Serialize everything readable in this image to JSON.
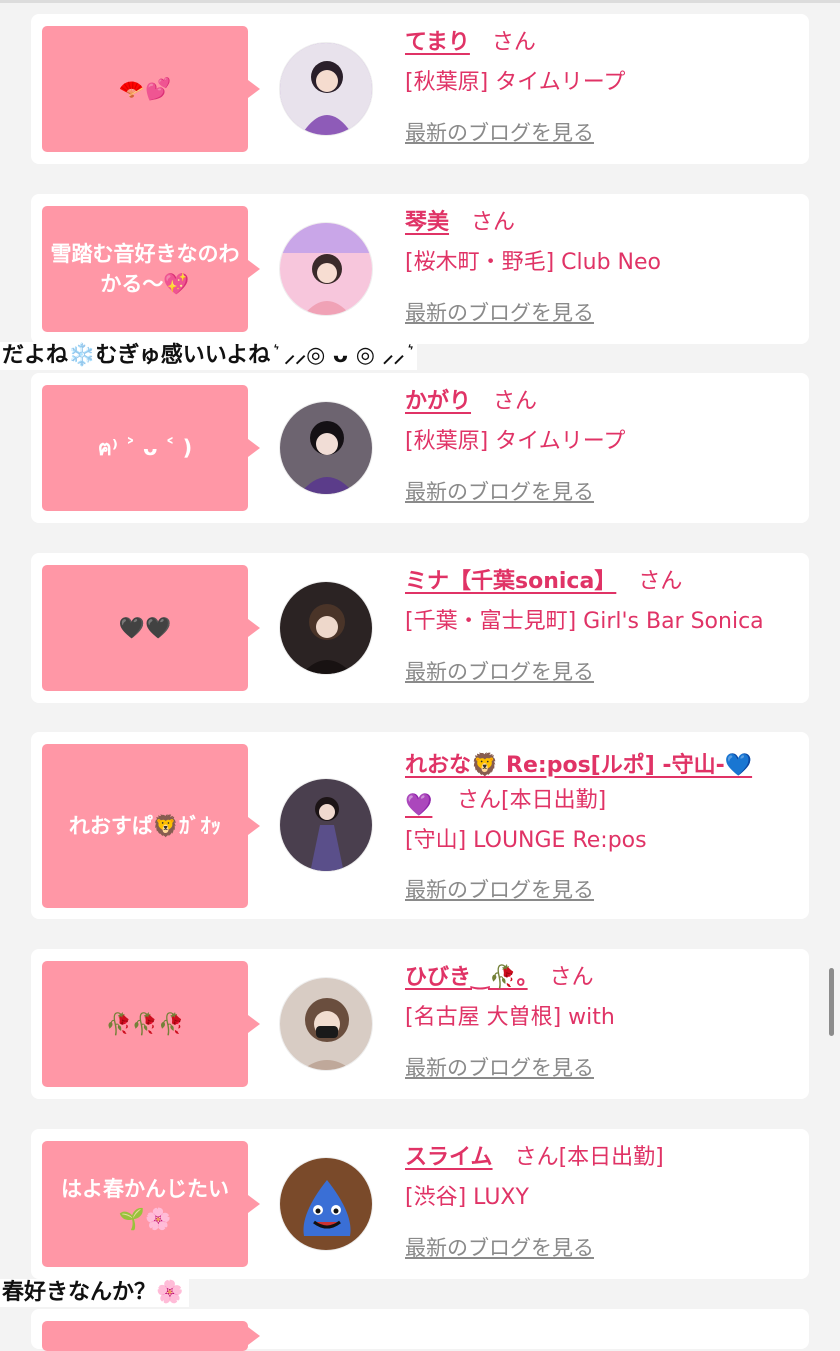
{
  "entries": [
    {
      "bubble": "🪭💕",
      "name": "てまり",
      "san": "さん",
      "status": "",
      "shop": "[秋葉原] タイムリープ",
      "blog": "最新のブログを見る",
      "avatar_color": "#b58fd0"
    },
    {
      "bubble": "雪踏む音好きなのわかる〜💖",
      "name": "琴美",
      "san": "さん",
      "status": "",
      "shop": "[桜木町・野毛] Club Neo",
      "blog": "最新のブログを見る",
      "avatar_color": "#f2b3cf"
    },
    {
      "bubble": "ฅ⁾ ˃ ᴗ ˂ )",
      "name": "かがり",
      "san": "さん",
      "status": "",
      "shop": "[秋葉原] タイムリープ",
      "blog": "最新のブログを見る",
      "avatar_color": "#5c4a6b"
    },
    {
      "bubble": "🖤🖤",
      "name": "ミナ【千葉sonica】",
      "san": "さん",
      "status": "",
      "shop": "[千葉・富士見町] Girl's Bar Sonica",
      "blog": "最新のブログを見る",
      "avatar_color": "#3b2f2f"
    },
    {
      "bubble": "れおすぱ🦁ｶﾞｵｯ",
      "name": "れおな🦁 Re:pos[ルポ] -守山-💙💜",
      "san": "さん",
      "status": "[本日出勤]",
      "shop": "[守山] LOUNGE Re:pos",
      "blog": "最新のブログを見る",
      "avatar_color": "#4a3f5e"
    },
    {
      "bubble": "🥀🥀🥀",
      "name": "ひびき‿🥀｡",
      "san": "さん",
      "status": "",
      "shop": "[名古屋 大曽根] with",
      "blog": "最新のブログを見る",
      "avatar_color": "#a79488"
    },
    {
      "bubble": "はよ春かんじたい🌱🌸",
      "name": "スライム",
      "san": "さん",
      "status": "[本日出勤]",
      "shop": "[渋谷] LUXY",
      "blog": "最新のブログを見る",
      "avatar_color": "#3566c9"
    }
  ],
  "overlays": {
    "text1": "だよね❄️むぎゅ感いいよね ͛ ‪⸝‬‪⸝‬◎ ᴗ ◎ ‪⸝‬‪⸝‬ ͛",
    "text2": "春好きなんか？🌸"
  },
  "colors": {
    "accent": "#e03366",
    "bubble": "#ff97a6",
    "link_gray": "#8a8a8a"
  }
}
